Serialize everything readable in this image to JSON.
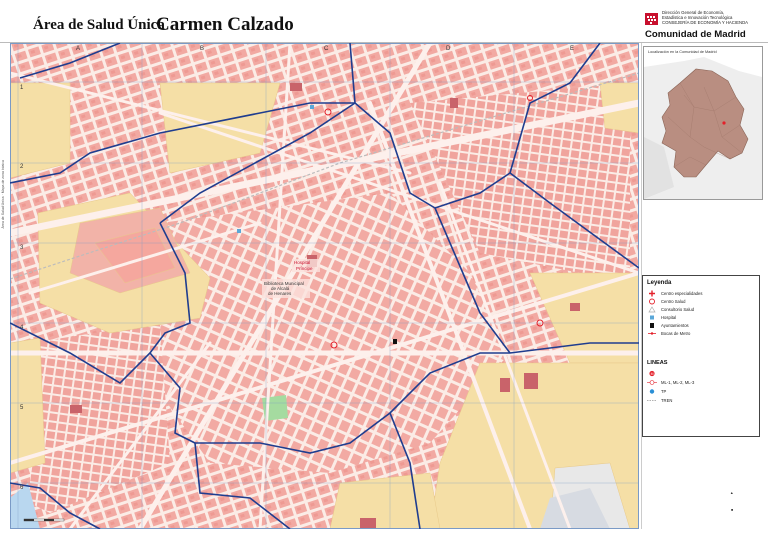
{
  "header": {
    "area_title": "Área de Salud Única",
    "district_name": "Carmen Calzado",
    "org_lines": [
      "Dirección General de Economía,",
      "Estadística e Innovación Tecnológica",
      "CONSEJERÍA DE ECONOMÍA Y HACIENDA"
    ],
    "brand": "Comunidad de Madrid"
  },
  "grid": {
    "columns": [
      "A",
      "B",
      "C",
      "D",
      "E"
    ],
    "rows": [
      "1",
      "2",
      "3",
      "4",
      "5",
      "6"
    ]
  },
  "map_labels": {
    "museum": [
      "Biblioteca Municipal",
      "de Alcalá",
      "de Henares"
    ],
    "hospital": [
      "Hospital",
      "Príncipe"
    ]
  },
  "inset": {
    "title": "Localización en la Comunidad de Madrid"
  },
  "legend": {
    "title": "Leyenda",
    "items": [
      {
        "label": "Centro especialidades",
        "icon": "red-cross-icon"
      },
      {
        "label": "Centro Salud",
        "icon": "red-circle-icon"
      },
      {
        "label": "Consultorio Salud",
        "icon": "triangle-icon"
      },
      {
        "label": "Hospital",
        "icon": "hospital-square-icon"
      },
      {
        "label": "Ayuntamientos",
        "icon": "town-hall-icon"
      },
      {
        "label": "Bocas de Metro",
        "icon": "metro-entrance-icon"
      }
    ],
    "lines_title": "LINEAS",
    "lines": [
      {
        "label": "",
        "icon": "metro-line-icon"
      },
      {
        "label": "ML-1, ML-2, ML-3",
        "icon": "light-rail-icon"
      },
      {
        "label": "TP",
        "icon": "tp-icon"
      },
      {
        "label": "TREN",
        "icon": "train-line-icon"
      }
    ]
  },
  "colors": {
    "urban_block": "#f2a9a2",
    "street": "#fdf0ec",
    "open_land": "#f5dfa6",
    "boundary": "#1f3d8f",
    "park": "#a5dba0",
    "brand_red": "#c8102e"
  }
}
